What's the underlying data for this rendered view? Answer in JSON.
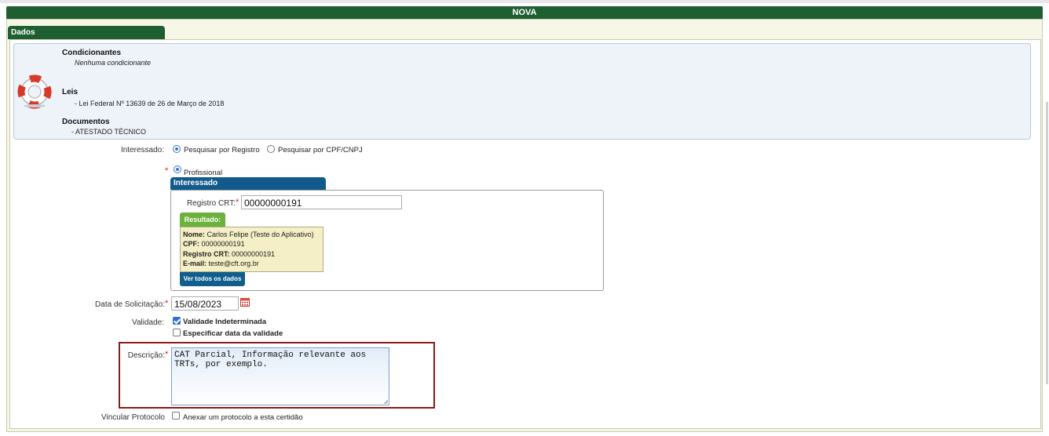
{
  "header": {
    "title": "NOVA"
  },
  "tabs": {
    "dados": "Dados"
  },
  "info": {
    "condicionantes_title": "Condicionantes",
    "condicionantes_value": "Nenhuma condicionante",
    "leis_title": "Leis",
    "leis_value": "- Lei Federal Nº 13639 de 26 de Março de 2018",
    "documentos_title": "Documentos",
    "documentos_value": "- ATESTADO TÉCNICO",
    "icon": "lifebuoy-icon"
  },
  "form": {
    "interessado_label": "Interessado:",
    "radio_registro": "Pesquisar por Registro",
    "radio_cpf": "Pesquisar por CPF/CNPJ",
    "radio_profissional": "Profissional",
    "interessado_tab": "Interessado",
    "registro_label": "Registro CRT:",
    "registro_value": "00000000191",
    "resultado_tab": "Resultado:",
    "resultado": {
      "nome_label": "Nome:",
      "nome_value": "Carlos Felipe (Teste do Aplicativo)",
      "cpf_label": "CPF:",
      "cpf_value": "00000000191",
      "registro_label": "Registro CRT:",
      "registro_value": "00000000191",
      "email_label": "E-mail:",
      "email_value": "teste@cft.org.br"
    },
    "ver_todos": "Ver todos os dados",
    "data_label": "Data de Solicitação:",
    "data_value": "15/08/2023",
    "validade_label": "Validade:",
    "validade_indeterminada": "Validade Indeterminada",
    "especificar_data": "Especificar data da validade",
    "descricao_label": "Descrição:",
    "descricao_value": "CAT Parcial, Informação relevante aos\nTRTs, por exemplo.",
    "vincular_label": "Vincular Protocolo",
    "anexar_label": "Anexar um protocolo a esta certidão",
    "required_mark": "*"
  },
  "colors": {
    "header_green": "#1e5e31",
    "tab_blue": "#115a8b",
    "result_green": "#6bb13c",
    "highlight_red": "#8b1b1b"
  }
}
